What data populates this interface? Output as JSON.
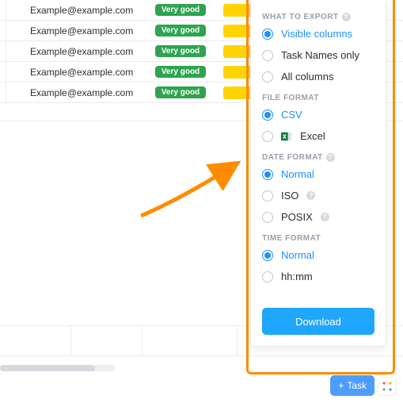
{
  "table": {
    "rows": [
      {
        "email": "Example@example.com",
        "badge": "Very good"
      },
      {
        "email": "Example@example.com",
        "badge": "Very good"
      },
      {
        "email": "Example@example.com",
        "badge": "Very good"
      },
      {
        "email": "Example@example.com",
        "badge": "Very good"
      },
      {
        "email": "Example@example.com",
        "badge": "Very good"
      }
    ]
  },
  "export": {
    "section_what": "WHAT TO EXPORT",
    "what_options": {
      "visible": "Visible columns",
      "names": "Task Names only",
      "all": "All columns"
    },
    "section_file": "FILE FORMAT",
    "file_options": {
      "csv": "CSV",
      "excel": "Excel"
    },
    "section_date": "DATE FORMAT",
    "date_options": {
      "normal": "Normal",
      "iso": "ISO",
      "posix": "POSIX"
    },
    "section_time": "TIME FORMAT",
    "time_options": {
      "normal": "Normal",
      "hhmm": "hh:mm"
    },
    "download_label": "Download"
  },
  "footer": {
    "task_label": "Task"
  }
}
